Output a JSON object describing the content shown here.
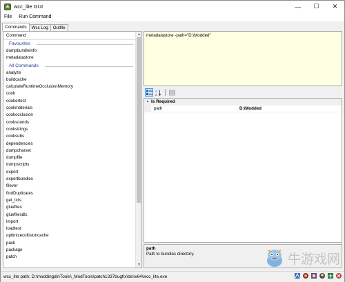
{
  "window": {
    "title": "wcc_lite GUI",
    "controls": {
      "minimize": "—",
      "maximize": "☐",
      "close": "✕"
    }
  },
  "menu": {
    "file": "File",
    "run_command": "Run Command"
  },
  "tabs": [
    {
      "label": "Commands",
      "active": true
    },
    {
      "label": "Wcc Log",
      "active": false
    },
    {
      "label": "Outfile",
      "active": false
    }
  ],
  "commands_panel": {
    "header": "Command",
    "favourites_label": "Favourites",
    "favourites": [
      "dumpbundleinfo",
      "metadatastore"
    ],
    "all_label": "All Commands",
    "all": [
      "analyze",
      "buildcache",
      "calculateRuntimeOcclusionMemory",
      "cook",
      "cookertest",
      "cookmaterials",
      "cookocclusion",
      "cooksounds",
      "cookstrings",
      "cooksubs",
      "dependencies",
      "dumpcharset",
      "dumpfile",
      "dumpscripts",
      "export",
      "exportbundles",
      "filever",
      "findDuplicates",
      "get_txts",
      "gluefiles",
      "gluefilesdlc",
      "import",
      "loadtest",
      "optimizecollisioncache",
      "pack",
      "package",
      "patch"
    ]
  },
  "command_text": "metadatastore -path=\"D:\\Modded\"",
  "property_grid": {
    "toolbar_icons": [
      "categorized-icon",
      "alphabetical-icon",
      "property-pages-icon"
    ],
    "category": "Is Required",
    "rows": [
      {
        "name": "path",
        "value": "D:\\Modded"
      }
    ],
    "description": {
      "title": "path",
      "text": "Path to bundles directory."
    }
  },
  "watermark_text": "牛游戏网",
  "status": {
    "text": "wcc_lite path: D:\\moddingdir\\Tools\\_ModTools\\patch1337bugfix\\bin\\x64\\wcc_lite.exe"
  },
  "colors": {
    "textarea_bg": "#ffffe1",
    "group_label": "#1e3f8a",
    "selection_blue": "#3399ff"
  }
}
